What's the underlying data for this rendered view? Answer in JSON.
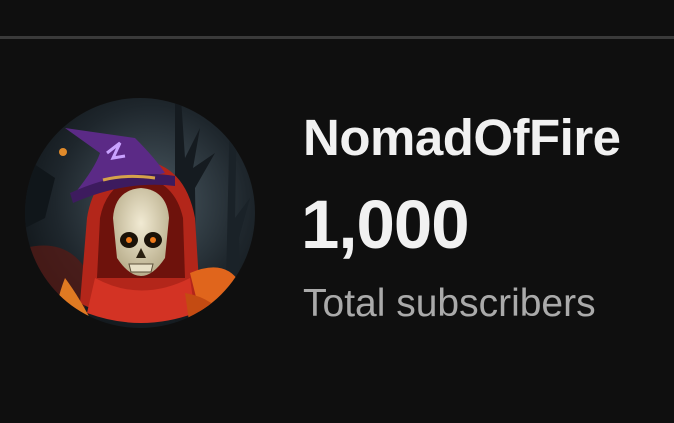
{
  "channel": {
    "name": "NomadOfFire",
    "subscriber_count": "1,000",
    "subscriber_label": "Total subscribers"
  },
  "avatar": {
    "icon": "skull-wizard-avatar-icon",
    "hat_color": "#5b2a86",
    "hood_color": "#c0281c"
  },
  "next_section": {
    "heading": ""
  }
}
